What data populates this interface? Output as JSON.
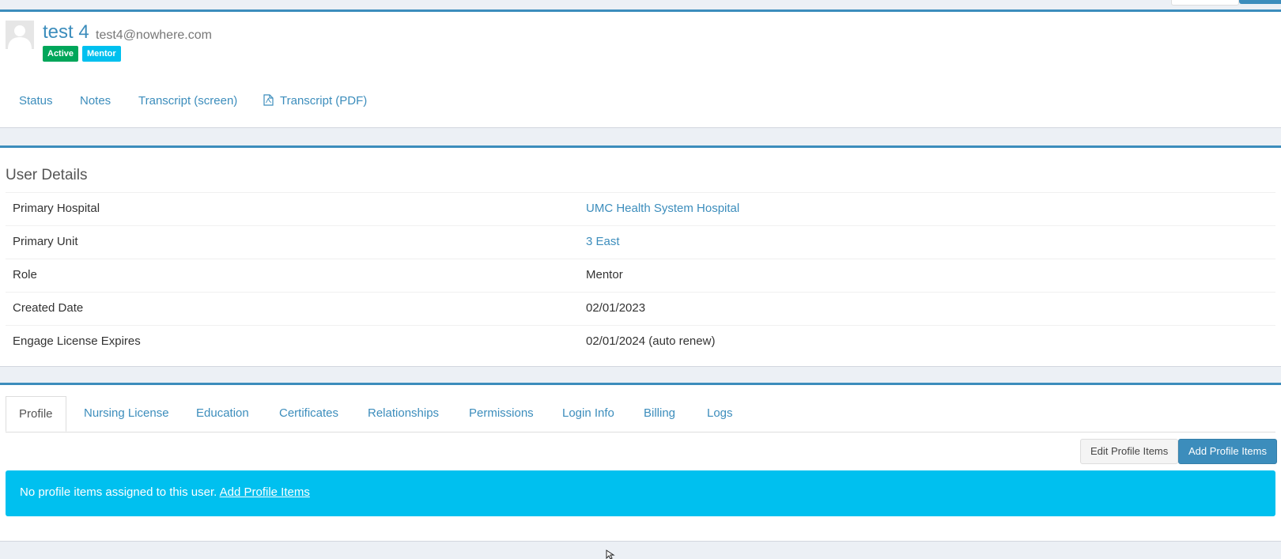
{
  "user": {
    "name": "test 4",
    "email": "test4@nowhere.com",
    "badges": {
      "active": "Active",
      "mentor": "Mentor"
    }
  },
  "header_nav": {
    "status": "Status",
    "notes": "Notes",
    "transcript_screen": "Transcript (screen)",
    "transcript_pdf": "Transcript (PDF)"
  },
  "details": {
    "title": "User Details",
    "rows": [
      {
        "label": "Primary Hospital",
        "value": "UMC Health System Hospital"
      },
      {
        "label": "Primary Unit",
        "value": "3 East"
      },
      {
        "label": "Role",
        "value": "Mentor"
      },
      {
        "label": "Created Date",
        "value": "02/01/2023"
      },
      {
        "label": "Engage License Expires",
        "value": "02/01/2024 (auto renew)"
      }
    ]
  },
  "tabs": {
    "profile": "Profile",
    "nursing_license": "Nursing License",
    "education": "Education",
    "certificates": "Certificates",
    "relationships": "Relationships",
    "permissions": "Permissions",
    "login_info": "Login Info",
    "billing": "Billing",
    "logs": "Logs"
  },
  "actions": {
    "edit_profile_items": "Edit Profile Items",
    "add_profile_items": "Add Profile Items"
  },
  "callout": {
    "message": "No profile items assigned to this user.",
    "link": "Add Profile Items"
  },
  "colors": {
    "primary": "#3c8dbc",
    "active_badge": "#00a65a",
    "info": "#00c0ef",
    "page_bg": "#ecf0f5"
  }
}
